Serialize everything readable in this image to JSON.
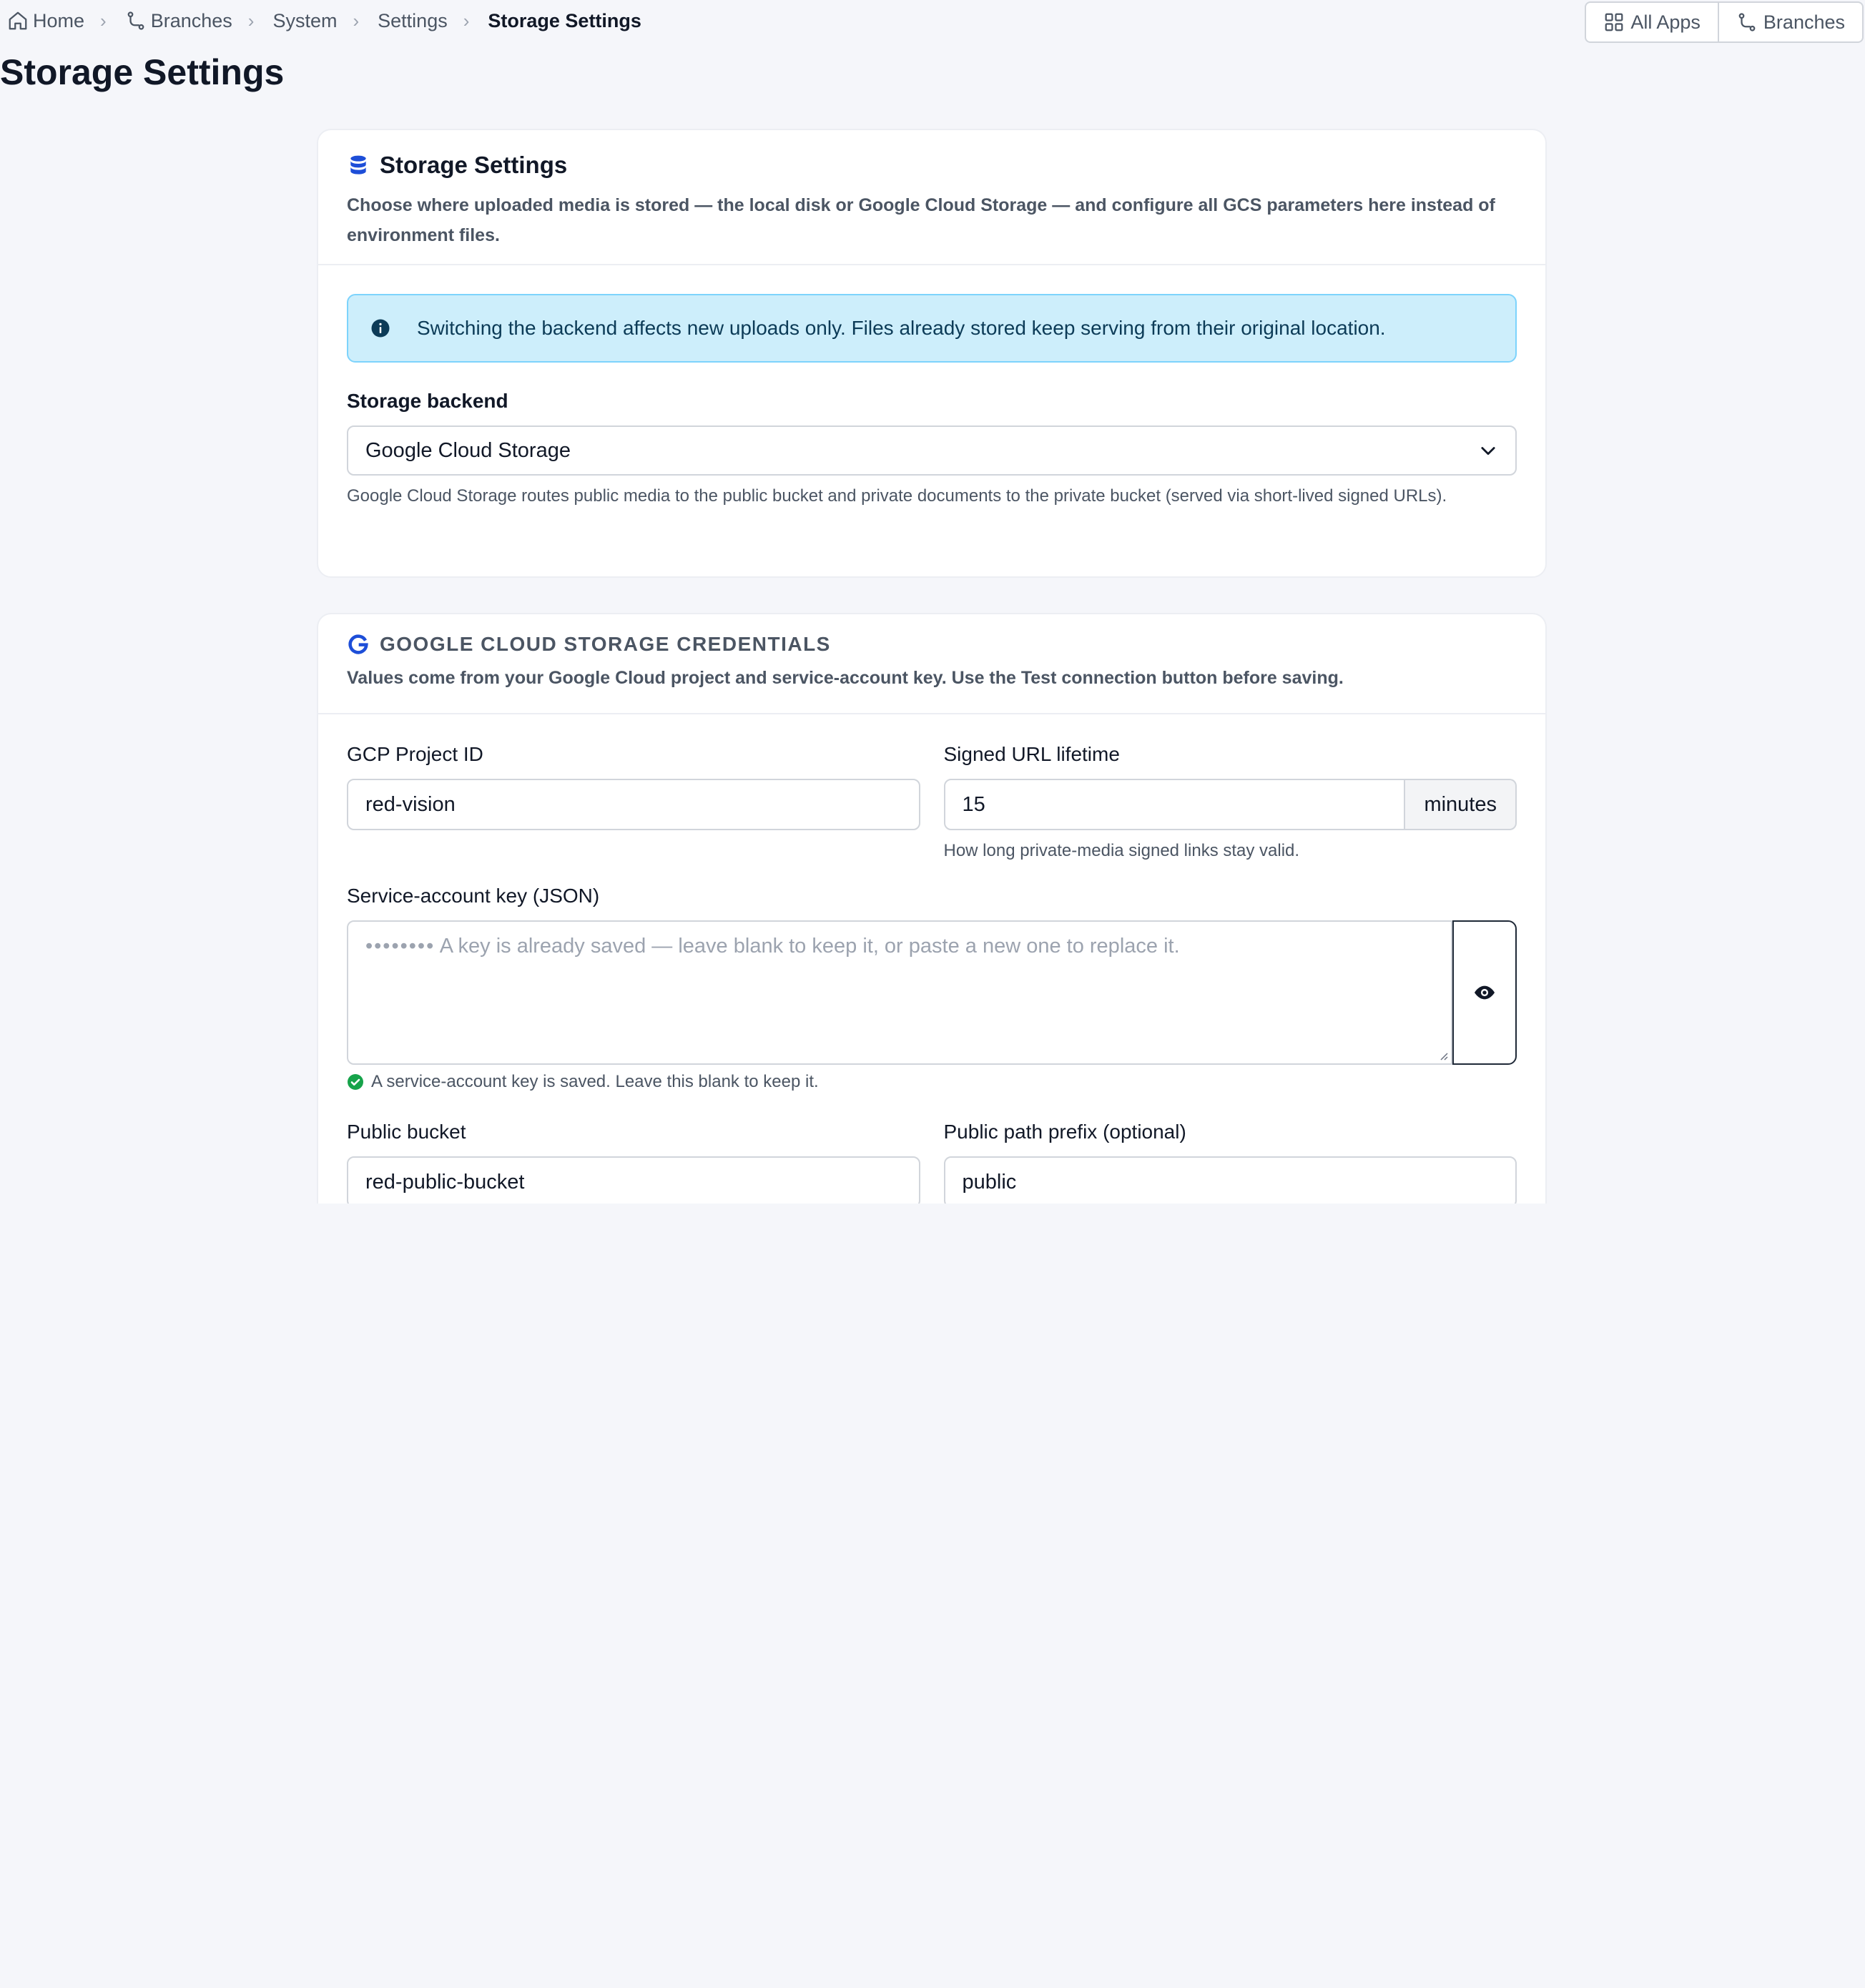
{
  "breadcrumb": {
    "home": "Home",
    "branches": "Branches",
    "system": "System",
    "settings": "Settings",
    "current": "Storage Settings"
  },
  "top_actions": {
    "all_apps": "All Apps",
    "branches": "Branches"
  },
  "page_title": "Storage Settings",
  "storage_card": {
    "title": "Storage Settings",
    "description": "Choose where uploaded media is stored — the local disk or Google Cloud Storage — and configure all GCS parameters here instead of environment files.",
    "alert": "Switching the backend affects new uploads only. Files already stored keep serving from their original location.",
    "backend_label": "Storage backend",
    "backend_value": "Google Cloud Storage",
    "backend_help": "Google Cloud Storage routes public media to the public bucket and private documents to the private bucket (served via short-lived signed URLs)."
  },
  "gcs_card": {
    "title": "GOOGLE CLOUD STORAGE CREDENTIALS",
    "description": "Values come from your Google Cloud project and service-account key. Use the Test connection button before saving.",
    "project_id_label": "GCP Project ID",
    "project_id_value": "red-vision",
    "signed_url_label": "Signed URL lifetime",
    "signed_url_value": "15",
    "signed_url_unit": "minutes",
    "signed_url_help": "How long private-media signed links stay valid.",
    "key_label": "Service-account key (JSON)",
    "key_dots": "••••••••",
    "key_placeholder": "A key is already saved — leave blank to keep it, or paste a new one to replace it.",
    "key_saved_help": "A service-account key is saved. Leave this blank to keep it.",
    "public_bucket_label": "Public bucket",
    "public_bucket_value": "red-public-bucket",
    "public_prefix_label": "Public path prefix (optional)",
    "public_prefix_value": "public"
  },
  "colors": {
    "accent": "#1d4ed8",
    "info_bg": "#cdeefb",
    "info_border": "#7dd3fc",
    "success": "#16a34a",
    "page_bg": "#f5f6fa"
  },
  "icons": [
    "home-icon",
    "branch-icon",
    "chevron-right-icon",
    "grid-icon",
    "database-icon",
    "info-icon",
    "chevron-down-icon",
    "google-icon",
    "eye-icon",
    "check-circle-icon"
  ]
}
